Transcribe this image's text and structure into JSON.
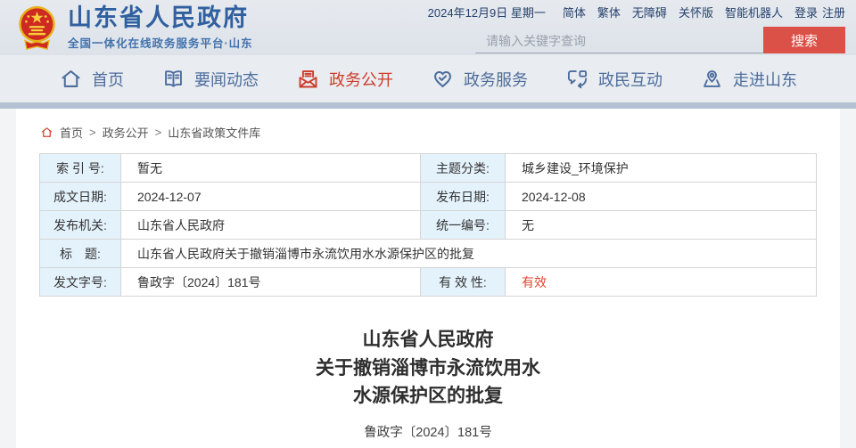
{
  "header": {
    "site_title": "山东省人民政府",
    "site_subtitle": "全国一体化在线政务服务平台·山东",
    "date": "2024年12月9日 星期一",
    "links": {
      "simplified": "简体",
      "traditional": "繁体",
      "accessibility": "无障碍",
      "care_version": "关怀版",
      "robot": "智能机器人",
      "login": "登录",
      "register": "注册"
    },
    "search": {
      "placeholder": "请输入关键字查询",
      "button_label": "搜索"
    }
  },
  "nav": {
    "items": [
      {
        "label": "首页",
        "icon": "home-icon",
        "active": false
      },
      {
        "label": "要闻动态",
        "icon": "book-icon",
        "active": false
      },
      {
        "label": "政务公开",
        "icon": "envelope-doc-icon",
        "active": true
      },
      {
        "label": "政务服务",
        "icon": "heart-icon",
        "active": false
      },
      {
        "label": "政民互动",
        "icon": "chat-bubbles-icon",
        "active": false
      },
      {
        "label": "走进山东",
        "icon": "map-pin-icon",
        "active": false
      }
    ]
  },
  "breadcrumb": {
    "items": [
      "首页",
      "政务公开",
      "山东省政策文件库"
    ],
    "separator": ">"
  },
  "info_table": {
    "rows": [
      {
        "label1": "索 引 号:",
        "value1": "暂无",
        "label2": "主题分类:",
        "value2": "城乡建设_环境保护"
      },
      {
        "label1": "成文日期:",
        "value1": "2024-12-07",
        "label2": "发布日期:",
        "value2": "2024-12-08"
      },
      {
        "label1": "发布机关:",
        "value1": "山东省人民政府",
        "label2": "统一编号:",
        "value2": "无"
      },
      {
        "label1": "标　题:",
        "value1": "山东省人民政府关于撤销淄博市永流饮用水水源保护区的批复"
      },
      {
        "label1": "发文字号:",
        "value1": "鲁政字〔2024〕181号",
        "label2": "有 效 性:",
        "value2": "有效",
        "value2_status": "valid"
      }
    ]
  },
  "document": {
    "title_lines": [
      "山东省人民政府",
      "关于撤销淄博市永流饮用水",
      "水源保护区的批复"
    ],
    "doc_number": "鲁政字〔2024〕181号"
  },
  "colors": {
    "brand_blue": "#30609f",
    "nav_blue": "#4d6d9d",
    "active_red": "#ce3c2c",
    "search_button_red": "#dc5147",
    "valid_status_red": "#e0452f",
    "table_label_bg": "#e4f2fb",
    "divider_blue_gray": "#b3c1d3"
  }
}
